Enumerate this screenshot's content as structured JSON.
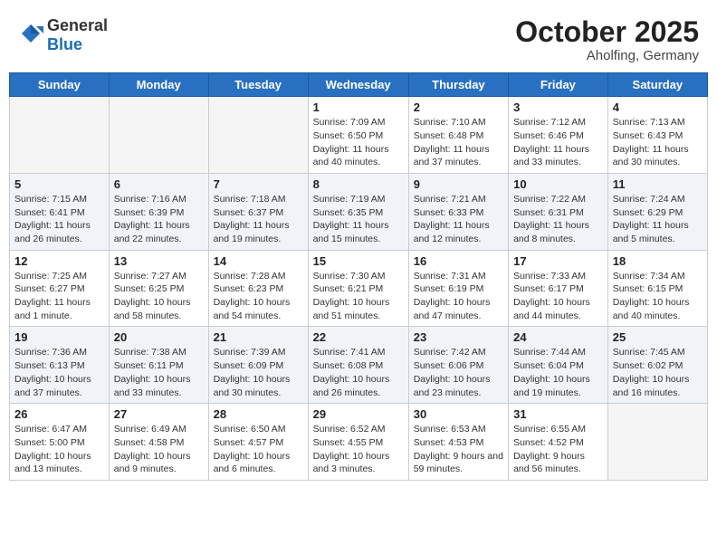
{
  "header": {
    "logo_general": "General",
    "logo_blue": "Blue",
    "month_title": "October 2025",
    "location": "Aholfing, Germany"
  },
  "calendar": {
    "days_of_week": [
      "Sunday",
      "Monday",
      "Tuesday",
      "Wednesday",
      "Thursday",
      "Friday",
      "Saturday"
    ],
    "weeks": [
      {
        "days": [
          {
            "number": "",
            "detail": "",
            "empty": true
          },
          {
            "number": "",
            "detail": "",
            "empty": true
          },
          {
            "number": "",
            "detail": "",
            "empty": true
          },
          {
            "number": "1",
            "detail": "Sunrise: 7:09 AM\nSunset: 6:50 PM\nDaylight: 11 hours and 40 minutes.",
            "empty": false
          },
          {
            "number": "2",
            "detail": "Sunrise: 7:10 AM\nSunset: 6:48 PM\nDaylight: 11 hours and 37 minutes.",
            "empty": false
          },
          {
            "number": "3",
            "detail": "Sunrise: 7:12 AM\nSunset: 6:46 PM\nDaylight: 11 hours and 33 minutes.",
            "empty": false
          },
          {
            "number": "4",
            "detail": "Sunrise: 7:13 AM\nSunset: 6:43 PM\nDaylight: 11 hours and 30 minutes.",
            "empty": false
          }
        ]
      },
      {
        "days": [
          {
            "number": "5",
            "detail": "Sunrise: 7:15 AM\nSunset: 6:41 PM\nDaylight: 11 hours and 26 minutes.",
            "empty": false
          },
          {
            "number": "6",
            "detail": "Sunrise: 7:16 AM\nSunset: 6:39 PM\nDaylight: 11 hours and 22 minutes.",
            "empty": false
          },
          {
            "number": "7",
            "detail": "Sunrise: 7:18 AM\nSunset: 6:37 PM\nDaylight: 11 hours and 19 minutes.",
            "empty": false
          },
          {
            "number": "8",
            "detail": "Sunrise: 7:19 AM\nSunset: 6:35 PM\nDaylight: 11 hours and 15 minutes.",
            "empty": false
          },
          {
            "number": "9",
            "detail": "Sunrise: 7:21 AM\nSunset: 6:33 PM\nDaylight: 11 hours and 12 minutes.",
            "empty": false
          },
          {
            "number": "10",
            "detail": "Sunrise: 7:22 AM\nSunset: 6:31 PM\nDaylight: 11 hours and 8 minutes.",
            "empty": false
          },
          {
            "number": "11",
            "detail": "Sunrise: 7:24 AM\nSunset: 6:29 PM\nDaylight: 11 hours and 5 minutes.",
            "empty": false
          }
        ]
      },
      {
        "days": [
          {
            "number": "12",
            "detail": "Sunrise: 7:25 AM\nSunset: 6:27 PM\nDaylight: 11 hours and 1 minute.",
            "empty": false
          },
          {
            "number": "13",
            "detail": "Sunrise: 7:27 AM\nSunset: 6:25 PM\nDaylight: 10 hours and 58 minutes.",
            "empty": false
          },
          {
            "number": "14",
            "detail": "Sunrise: 7:28 AM\nSunset: 6:23 PM\nDaylight: 10 hours and 54 minutes.",
            "empty": false
          },
          {
            "number": "15",
            "detail": "Sunrise: 7:30 AM\nSunset: 6:21 PM\nDaylight: 10 hours and 51 minutes.",
            "empty": false
          },
          {
            "number": "16",
            "detail": "Sunrise: 7:31 AM\nSunset: 6:19 PM\nDaylight: 10 hours and 47 minutes.",
            "empty": false
          },
          {
            "number": "17",
            "detail": "Sunrise: 7:33 AM\nSunset: 6:17 PM\nDaylight: 10 hours and 44 minutes.",
            "empty": false
          },
          {
            "number": "18",
            "detail": "Sunrise: 7:34 AM\nSunset: 6:15 PM\nDaylight: 10 hours and 40 minutes.",
            "empty": false
          }
        ]
      },
      {
        "days": [
          {
            "number": "19",
            "detail": "Sunrise: 7:36 AM\nSunset: 6:13 PM\nDaylight: 10 hours and 37 minutes.",
            "empty": false
          },
          {
            "number": "20",
            "detail": "Sunrise: 7:38 AM\nSunset: 6:11 PM\nDaylight: 10 hours and 33 minutes.",
            "empty": false
          },
          {
            "number": "21",
            "detail": "Sunrise: 7:39 AM\nSunset: 6:09 PM\nDaylight: 10 hours and 30 minutes.",
            "empty": false
          },
          {
            "number": "22",
            "detail": "Sunrise: 7:41 AM\nSunset: 6:08 PM\nDaylight: 10 hours and 26 minutes.",
            "empty": false
          },
          {
            "number": "23",
            "detail": "Sunrise: 7:42 AM\nSunset: 6:06 PM\nDaylight: 10 hours and 23 minutes.",
            "empty": false
          },
          {
            "number": "24",
            "detail": "Sunrise: 7:44 AM\nSunset: 6:04 PM\nDaylight: 10 hours and 19 minutes.",
            "empty": false
          },
          {
            "number": "25",
            "detail": "Sunrise: 7:45 AM\nSunset: 6:02 PM\nDaylight: 10 hours and 16 minutes.",
            "empty": false
          }
        ]
      },
      {
        "days": [
          {
            "number": "26",
            "detail": "Sunrise: 6:47 AM\nSunset: 5:00 PM\nDaylight: 10 hours and 13 minutes.",
            "empty": false
          },
          {
            "number": "27",
            "detail": "Sunrise: 6:49 AM\nSunset: 4:58 PM\nDaylight: 10 hours and 9 minutes.",
            "empty": false
          },
          {
            "number": "28",
            "detail": "Sunrise: 6:50 AM\nSunset: 4:57 PM\nDaylight: 10 hours and 6 minutes.",
            "empty": false
          },
          {
            "number": "29",
            "detail": "Sunrise: 6:52 AM\nSunset: 4:55 PM\nDaylight: 10 hours and 3 minutes.",
            "empty": false
          },
          {
            "number": "30",
            "detail": "Sunrise: 6:53 AM\nSunset: 4:53 PM\nDaylight: 9 hours and 59 minutes.",
            "empty": false
          },
          {
            "number": "31",
            "detail": "Sunrise: 6:55 AM\nSunset: 4:52 PM\nDaylight: 9 hours and 56 minutes.",
            "empty": false
          },
          {
            "number": "",
            "detail": "",
            "empty": true
          }
        ]
      }
    ]
  }
}
